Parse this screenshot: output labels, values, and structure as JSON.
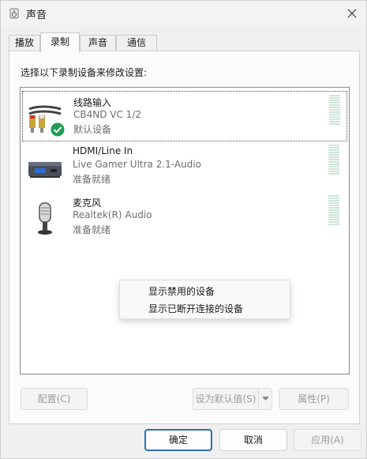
{
  "window": {
    "title": "声音"
  },
  "tabs": [
    {
      "label": "播放"
    },
    {
      "label": "录制"
    },
    {
      "label": "声音"
    },
    {
      "label": "通信"
    }
  ],
  "instruction": "选择以下录制设备来修改设置:",
  "devices": [
    {
      "name": "线路输入",
      "detail": "CB4ND VC 1/2",
      "status": "默认设备",
      "icon": "line-in-cable-icon",
      "badge": "default-check-icon"
    },
    {
      "name": "HDMI/Line In",
      "detail": "Live Gamer Ultra 2.1-Audio",
      "status": "准备就绪",
      "icon": "capture-device-icon"
    },
    {
      "name": "麦克风",
      "detail": "Realtek(R) Audio",
      "status": "准备就绪",
      "icon": "microphone-icon"
    }
  ],
  "context_menu": {
    "items": [
      {
        "label": "显示禁用的设备"
      },
      {
        "label": "显示已断开连接的设备"
      }
    ]
  },
  "panel_buttons": {
    "configure": "配置(C)",
    "set_default": "设为默认值(S)",
    "properties": "属性(P)"
  },
  "dialog_buttons": {
    "ok": "确定",
    "cancel": "取消",
    "apply": "应用(A)"
  },
  "colors": {
    "accent": "#2f6fb1",
    "meter": "#cfe4da",
    "check": "#1f9d55"
  }
}
